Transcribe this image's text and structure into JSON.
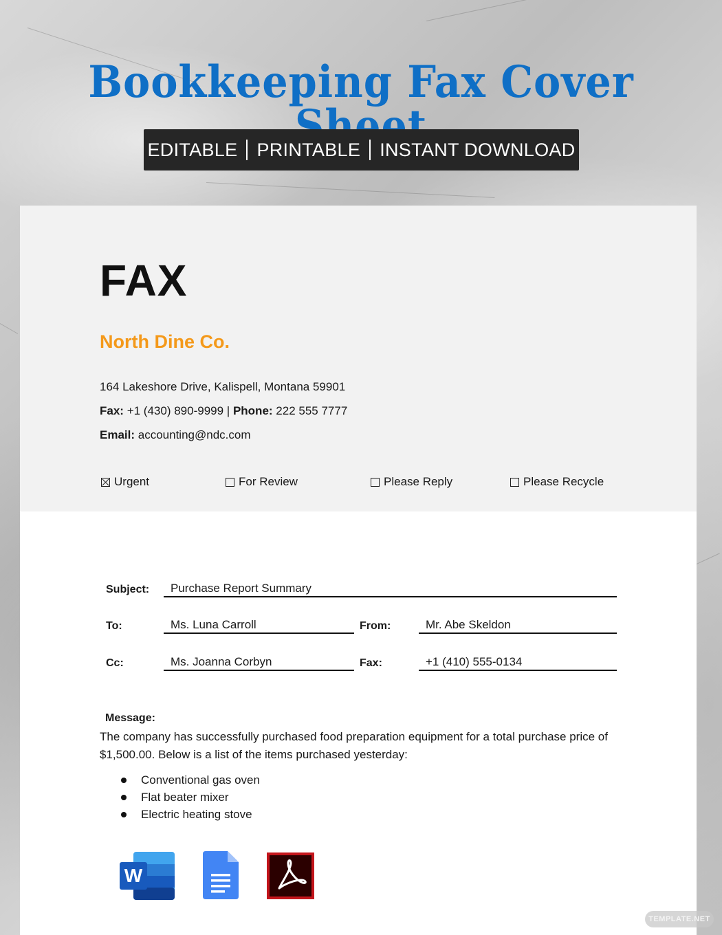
{
  "banner": {
    "title": "Bookkeeping Fax Cover Sheet",
    "tagline_items": [
      "EDITABLE",
      "PRINTABLE",
      "INSTANT DOWNLOAD"
    ]
  },
  "colors": {
    "title_blue": "#0f6fc6",
    "company_orange": "#f4991a",
    "tagline_bg": "#262626",
    "header_gray": "#f2f2f2"
  },
  "sheet": {
    "heading": "FAX",
    "company": "North Dine Co.",
    "address": "164 Lakeshore Drive, Kalispell, Montana 59901",
    "fax_label": "Fax:",
    "fax_value": "+1 (430) 890-9999",
    "separator": "|",
    "phone_label": "Phone:",
    "phone_value": "222 555 7777",
    "email_label": "Email:",
    "email_value": "accounting@ndc.com",
    "checkboxes": [
      {
        "label": "Urgent",
        "checked": true
      },
      {
        "label": "For Review",
        "checked": false
      },
      {
        "label": "Please Reply",
        "checked": false
      },
      {
        "label": "Please Recycle",
        "checked": false
      }
    ],
    "fields": {
      "subject_label": "Subject:",
      "subject_value": "Purchase Report Summary",
      "to_label": "To:",
      "to_value": "Ms. Luna Carroll",
      "from_label": "From:",
      "from_value": "Mr. Abe Skeldon",
      "cc_label": "Cc:",
      "cc_value": "Ms. Joanna Corbyn",
      "fax_label": "Fax:",
      "fax_value": "+1 (410) 555-0134"
    },
    "message": {
      "label": "Message:",
      "body": "The company has successfully purchased food preparation equipment for a total purchase price of $1,500.00. Below is a list of the items purchased yesterday:",
      "items": [
        "Conventional gas oven",
        "Flat beater mixer",
        "Electric heating stove"
      ]
    },
    "app_icons": [
      "word-icon",
      "google-docs-icon",
      "adobe-acrobat-icon"
    ]
  },
  "watermark": "TEMPLATE.NET"
}
